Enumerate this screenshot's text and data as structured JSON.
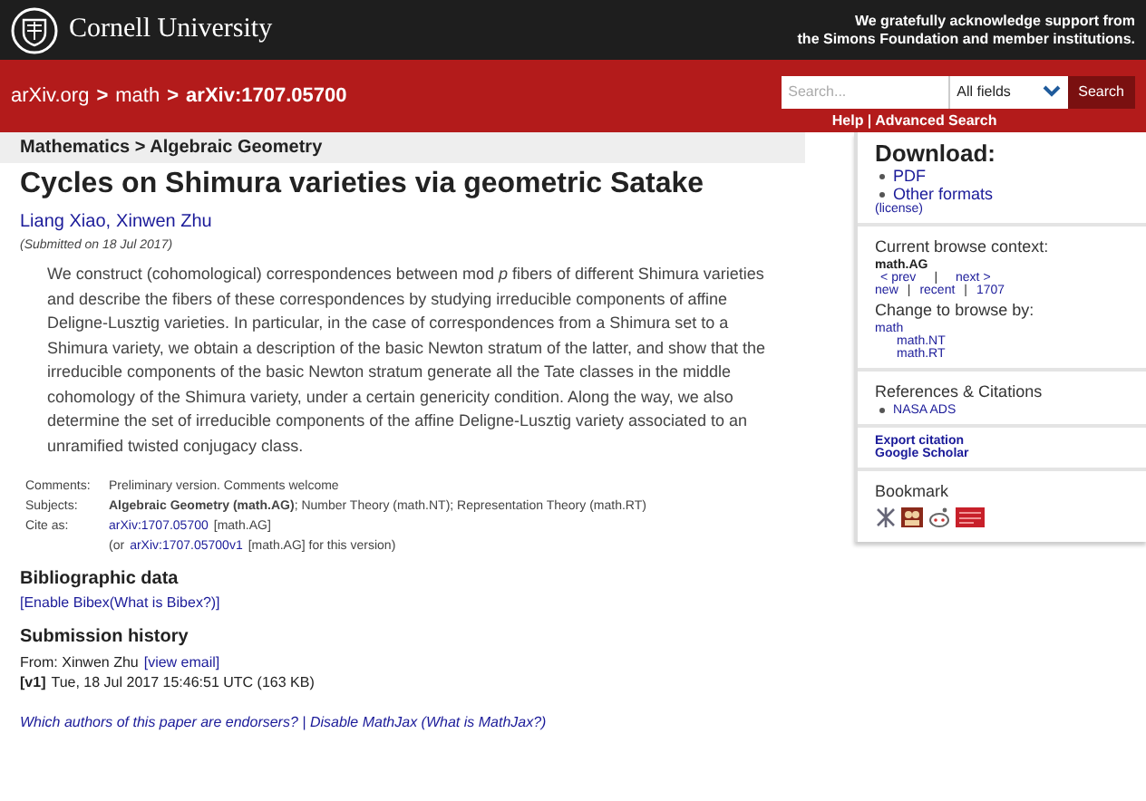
{
  "header": {
    "brand": "Cornell University",
    "acknowledgement_line_1": "We gratefully acknowledge support from",
    "acknowledgement_line_2": "the Simons Foundation and member institutions."
  },
  "nav": {
    "breadcrumb": [
      {
        "label": "arXiv.org",
        "current": false
      },
      {
        "label": "math",
        "current": false
      },
      {
        "label": "arXiv:1707.05700",
        "current": true
      }
    ],
    "separator": ">",
    "search": {
      "placeholder": "Search...",
      "field": "All fields",
      "button": "Search"
    },
    "help": "Help | Advanced Search"
  },
  "main": {
    "subject_bar": "Mathematics > Algebraic Geometry",
    "title": "Cycles on Shimura varieties via geometric Satake",
    "authors": [
      "Liang Xiao",
      "Xinwen Zhu"
    ],
    "author_separator": ",",
    "submitted": "(Submitted on 18 Jul 2017)",
    "abstract": "We construct (cohomological) correspondences between mod *p* fibers of different Shimura varieties and describe the fibers of these correspondences by studying irreducible components of affine Deligne-Lusztig varieties. In particular, in the case of correspondences from a Shimura set to a Shimura variety, we obtain a description of the basic Newton stratum of the latter, and show that the irreducible components of the basic Newton stratum generate all the Tate classes in the middle cohomology of the Shimura variety, under a certain genericity condition. Along the way, we also determine the set of irreducible components of the affine Deligne-Lusztig variety associated to an unramified twisted conjugacy class.",
    "metadata": [
      {
        "label": "Comments:",
        "value": "Preliminary version. Comments welcome"
      },
      {
        "label": "Subjects:",
        "value": "**Algebraic Geometry (math.AG)**; Number Theory (math.NT); Representation Theory (math.RT)"
      }
    ],
    "cite_label": "Cite as:",
    "cite_id": "arXiv:1707.05700",
    "cite_tag": "[math.AG]",
    "cite_or": "(or",
    "cite_version": "arXiv:1707.05700v1",
    "cite_version_tail": "[math.AG] for this version)",
    "bibliographic_heading": "Bibliographic data",
    "bibex_link": "[Enable Bibex(What is Bibex?)]",
    "history_heading": "Submission history",
    "from_label": "From: Xinwen Zhu",
    "view_email": "[view email]",
    "version_tag": "[v1]",
    "version_date": "Tue, 18 Jul 2017 15:46:51 UTC (163 KB)",
    "footer_links": "Which authors of this paper are endorsers? | Disable MathJax (What is MathJax?)"
  },
  "sidebar": {
    "download_heading": "Download:",
    "downloads": [
      "PDF",
      "Other formats"
    ],
    "license": "(license)",
    "context_heading": "Current browse context:",
    "context": "math.AG",
    "prev": "< prev",
    "pipe": "|",
    "next": "next >",
    "recent_links": [
      "new",
      "recent",
      "1707"
    ],
    "change_heading": "Change to browse by:",
    "browse": [
      {
        "label": "math",
        "children": [
          {
            "label": "math.NT"
          },
          {
            "label": "math.RT"
          }
        ]
      }
    ],
    "references_heading": "References & Citations",
    "references": [
      "NASA ADS"
    ],
    "export": "Export citation",
    "scholar": "Google Scholar",
    "bookmark_heading": "Bookmark"
  }
}
